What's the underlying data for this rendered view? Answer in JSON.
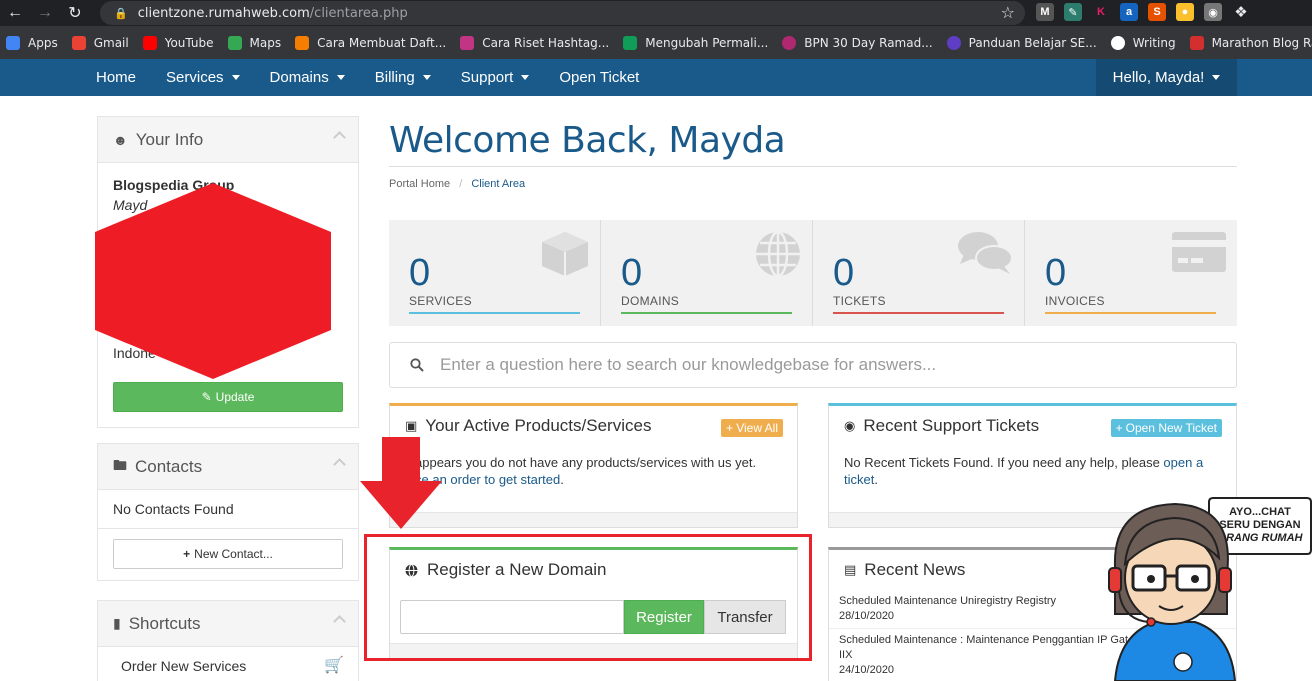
{
  "browser": {
    "url_host": "clientzone.rumahweb.com",
    "url_path": "/clientarea.php",
    "bookmarks": [
      {
        "label": "Apps",
        "color": "#4285f4"
      },
      {
        "label": "Gmail",
        "color": "#ea4335"
      },
      {
        "label": "YouTube",
        "color": "#ff0000"
      },
      {
        "label": "Maps",
        "color": "#34a853"
      },
      {
        "label": "Cara Membuat Daft...",
        "color": "#f57d00"
      },
      {
        "label": "Cara Riset Hashtag...",
        "color": "#c13584"
      },
      {
        "label": "Mengubah Permali...",
        "color": "#0f9d58"
      },
      {
        "label": "BPN 30 Day Ramad...",
        "color": "#b0286f"
      },
      {
        "label": "Panduan Belajar SE...",
        "color": "#5f3dc4"
      },
      {
        "label": "Writing",
        "color": "#ffffff"
      },
      {
        "label": "Marathon Blog Ra...",
        "color": "#d32f2f"
      }
    ]
  },
  "nav": {
    "home": "Home",
    "services": "Services",
    "domains": "Domains",
    "billing": "Billing",
    "support": "Support",
    "open_ticket": "Open Ticket",
    "hello": "Hello, Mayda!"
  },
  "sidebar": {
    "your_info": {
      "title": "Your Info",
      "company": "Blogspedia Group",
      "name_partial": "Mayd",
      "country_partial": "Indone",
      "update_label": "Update"
    },
    "contacts": {
      "title": "Contacts",
      "empty_text": "No Contacts Found",
      "new_contact_label": "New Contact..."
    },
    "shortcuts": {
      "title": "Shortcuts",
      "order_new_services": "Order New Services"
    }
  },
  "main": {
    "welcome_title": "Welcome Back, Mayda",
    "breadcrumb_home": "Portal Home",
    "breadcrumb_sep": "/",
    "breadcrumb_active": "Client Area",
    "stats": [
      {
        "value": "0",
        "label": "SERVICES",
        "color": "#5bc0de"
      },
      {
        "value": "0",
        "label": "DOMAINS",
        "color": "#5cb85c"
      },
      {
        "value": "0",
        "label": "TICKETS",
        "color": "#d9534f"
      },
      {
        "value": "0",
        "label": "INVOICES",
        "color": "#f0ad4e"
      }
    ],
    "kb_search_placeholder": "Enter a question here to search our knowledgebase for answers...",
    "products": {
      "title": "Your Active Products/Services",
      "view_all": "View All",
      "text_start": "appears you do not have any products/services with us yet.",
      "text_mid": "ce an order to get started",
      "text_link": "ce an order",
      "text_after": " to get started",
      "text_end": "."
    },
    "tickets": {
      "title": "Recent Support Tickets",
      "open_new": "Open New Ticket",
      "text": "No Recent Tickets Found. If you need any help, please ",
      "link": "open a ticket",
      "end": "."
    },
    "register": {
      "title": "Register a New Domain",
      "register_label": "Register",
      "transfer_label": "Transfer"
    },
    "news": {
      "title": "Recent News",
      "items": [
        {
          "title": "Scheduled Maintenance Uniregistry Registry",
          "date": "28/10/2020"
        },
        {
          "title": "Scheduled Maintenance : Maintenance Penggantian IP Gat... VPS dan Server IIX",
          "date": "24/10/2020"
        }
      ]
    }
  },
  "chat_widget": {
    "line1": "AYO...CHAT",
    "line2": "SERU DENGAN",
    "line3": "ORANG RUMAH"
  }
}
